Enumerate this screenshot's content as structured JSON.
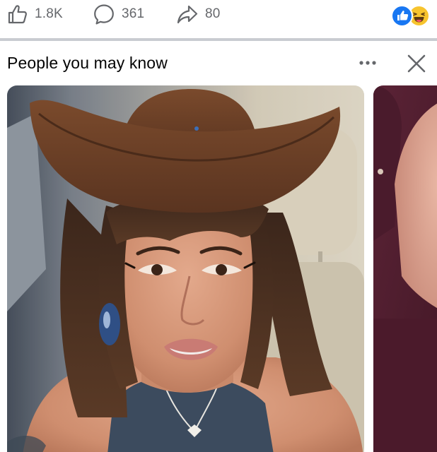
{
  "engagement": {
    "likes": "1.8K",
    "comments": "361",
    "shares": "80",
    "like_icon": "thumbs-up-outline-icon",
    "comment_icon": "speech-bubble-icon",
    "share_icon": "share-arrow-icon",
    "reactions": [
      "like-reaction-icon",
      "haha-reaction-icon"
    ]
  },
  "pymk": {
    "title": "People you may know",
    "more_icon": "more-options-icon",
    "close_icon": "close-icon"
  },
  "suggestions": [
    {
      "photo": "profile-photo-woman-cowboy-hat"
    },
    {
      "photo": "profile-photo-partial"
    }
  ],
  "colors": {
    "brand_blue": "#1877f2",
    "muted_text": "#65676b",
    "divider": "#c9ccd1",
    "haha_yellow": "#f7c42e"
  }
}
